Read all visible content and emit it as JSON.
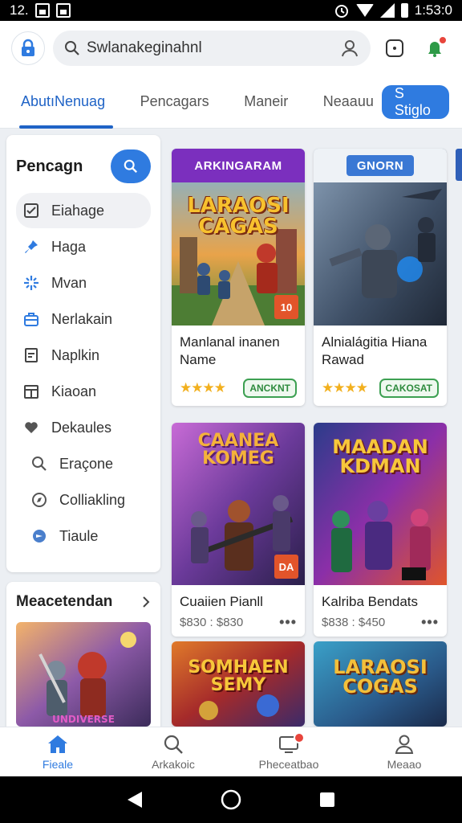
{
  "status": {
    "time_left": "12.",
    "time_right": "1:53:0"
  },
  "search": {
    "value": "Swlanakeginahnl"
  },
  "tabs": [
    {
      "label": "AbutıNenuag"
    },
    {
      "label": "Pencagars"
    },
    {
      "label": "Maneir"
    },
    {
      "label": "Neaauu"
    }
  ],
  "tab_button": {
    "label": "S Stiglo"
  },
  "sidebar": {
    "title": "Pencagn",
    "items": [
      {
        "label": "Eiahage",
        "icon": "checkbox-icon"
      },
      {
        "label": "Haga",
        "icon": "pin-icon"
      },
      {
        "label": "Mvan",
        "icon": "sparkle-icon"
      },
      {
        "label": "Nerlakain",
        "icon": "briefcase-icon"
      },
      {
        "label": "Naplkin",
        "icon": "document-icon"
      },
      {
        "label": "Kiaoan",
        "icon": "calendar-icon"
      },
      {
        "label": "Dekaules",
        "icon": "heart-icon"
      },
      {
        "label": "Eraçone",
        "icon": "search-icon"
      },
      {
        "label": "Colliakling",
        "icon": "compass-icon"
      },
      {
        "label": "Tiaule",
        "icon": "ribbon-icon"
      }
    ]
  },
  "recommended": {
    "title": "Meacetendan",
    "art_text": "UNDIVERSE"
  },
  "games": [
    {
      "banner": "ARKINGARAM",
      "art_title": "LARAOSI\nCAGAS",
      "badge": "10",
      "name": "Manlanal inanen Name",
      "stars": "★★★★",
      "tag": "ANCKNT"
    },
    {
      "banner": "GNORN",
      "art_title": "",
      "badge": "",
      "name": "Alnialágitia Hiana Rawad",
      "stars": "★★★★",
      "tag": "CAKOSAT"
    },
    {
      "banner": "",
      "art_title": "CAANEA\nKOMEG",
      "badge": "DA",
      "name": "Cuaiien Pianll",
      "price": "$830 : $830"
    },
    {
      "banner": "",
      "art_title": "MAADAN\nKDMAN",
      "badge": "",
      "name": "Kalriba Bendats",
      "price": "$838 : $450"
    },
    {
      "banner": "",
      "art_title": "SOMHAEN\nSEMY",
      "badge": "",
      "name": ""
    },
    {
      "banner": "",
      "art_title": "LARAOSI\nCOGAS",
      "badge": "",
      "name": ""
    }
  ],
  "bottom_nav": [
    {
      "label": "Fieale",
      "icon": "home-icon"
    },
    {
      "label": "Arkakoic",
      "icon": "search-icon"
    },
    {
      "label": "Pheceatbao",
      "icon": "monitor-icon"
    },
    {
      "label": "Meaao",
      "icon": "profile-icon"
    }
  ],
  "colors": {
    "accent": "#2f7be0",
    "star": "#f2b01e",
    "tag_green": "#3da052",
    "badge_red": "#e8453c"
  }
}
